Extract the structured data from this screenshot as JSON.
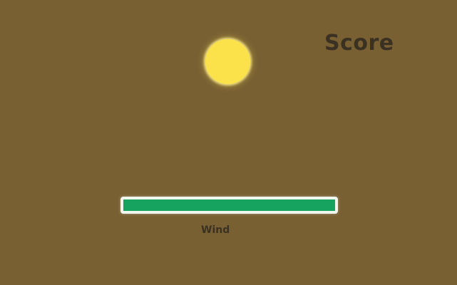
{
  "hud": {
    "score_label": "Score"
  },
  "wind": {
    "label": "Wind",
    "level": 1.0
  },
  "colors": {
    "background": "#786033",
    "ball": "#fbe14a",
    "wind_fill": "#16a360",
    "wind_border": "#eef6ee",
    "text": "#3b3122"
  },
  "icons": {
    "ball": "ball-icon"
  }
}
